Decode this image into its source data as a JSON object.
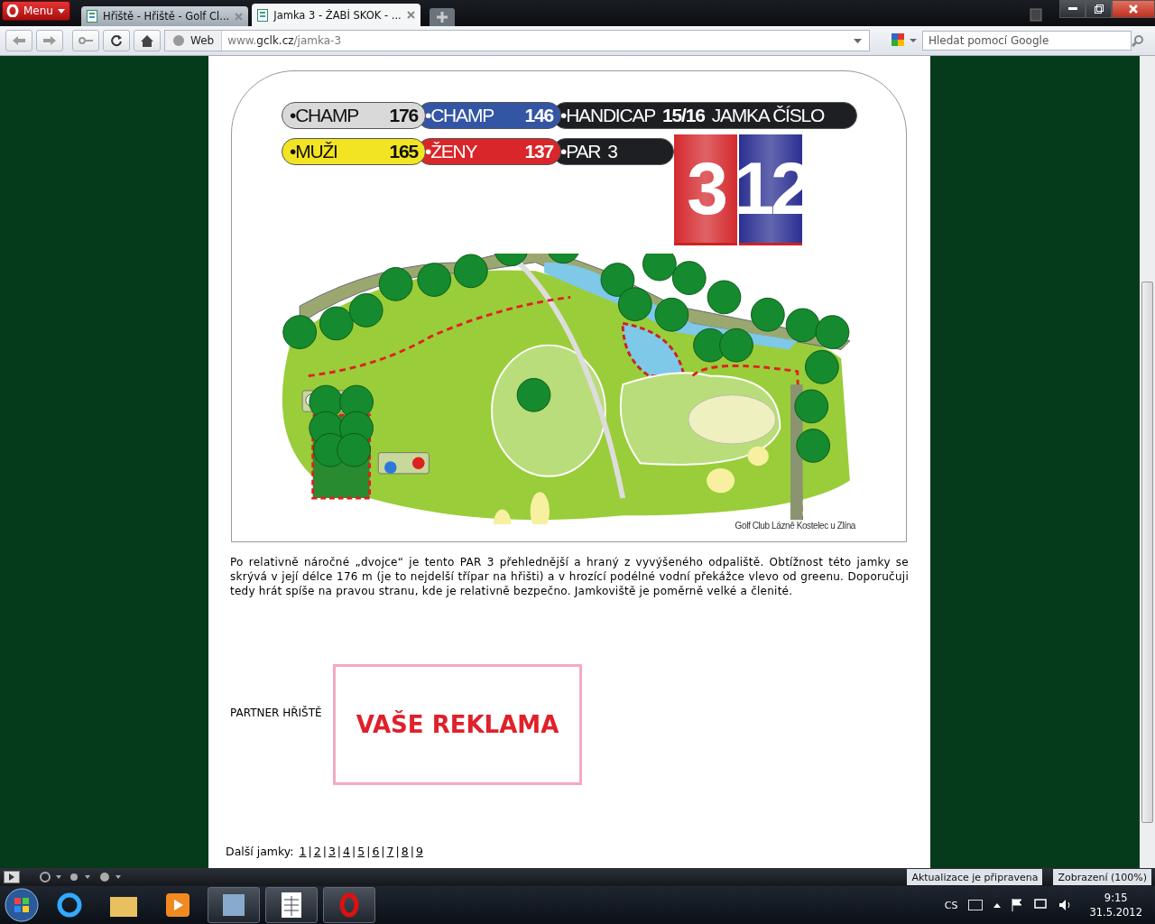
{
  "browser": {
    "menu_label": "Menu",
    "tabs": [
      {
        "title": "Hřiště - Hřiště - Golf Cl...",
        "selected": false
      },
      {
        "title": "Jamka 3 - ŽABÍ SKOK - ...",
        "selected": true
      }
    ],
    "address_label": "Web",
    "address": "www.**gclk.cz**/jamka-3",
    "search_placeholder": "Hledat pomocí Google"
  },
  "hole_card": {
    "rows": [
      [
        {
          "label": "•CHAMP",
          "value": "176",
          "value_bold": true,
          "color": "#d9d9d9"
        },
        {
          "label": "•CHAMP",
          "value": "146",
          "value_bold": true,
          "color": "#3455a4"
        },
        {
          "label": "•HANDICAP",
          "value": "15/16",
          "value_bold": true,
          "suffix": "JAMKA ČÍSLO",
          "color": "#1e1f22"
        }
      ],
      [
        {
          "label": "•MUŽI",
          "value": "165",
          "value_bold": true,
          "color": "#f2e422"
        },
        {
          "label": "•ŽENY",
          "value": "137",
          "value_bold": true,
          "color": "#d8262a"
        },
        {
          "label": "•PAR",
          "value": "3",
          "value_bold": false,
          "color": "#1e1f22"
        }
      ]
    ],
    "flags": [
      {
        "number": "3",
        "color": "#d42a2e"
      },
      {
        "number": "12",
        "color": "#2b2f92"
      }
    ],
    "credit": "Golf Club Lázně Kostelec u Zlína"
  },
  "description": "Po relativně náročné „dvojce“ je tento PAR 3 přehlednější a hraný z vyvýšeného odpaliště. Obtížnost této jamky se skrývá v její délce 176 m (je to nejdelší třípar na hřišti) a v hrozící podélné vodní překážce vlevo od greenu. Doporučuji tedy hrát spíše na pravou stranu, kde je relativně bezpečno. Jamkoviště je poměrně velké a členité.",
  "partner": {
    "label": "PARTNER HŘIŠTĚ",
    "ad": "VAŠE REKLAMA"
  },
  "hole_nav": {
    "label": "Další jamky:",
    "separator": "|",
    "links": [
      "1",
      "2",
      "3",
      "4",
      "5",
      "6",
      "7",
      "8",
      "9"
    ]
  },
  "status_bar": {
    "update": "Aktualizace je připravena",
    "zoom": "Zobrazení (100%)"
  },
  "taskbar": {
    "language": "CS",
    "time": "9:15",
    "date": "31.5.2012"
  }
}
